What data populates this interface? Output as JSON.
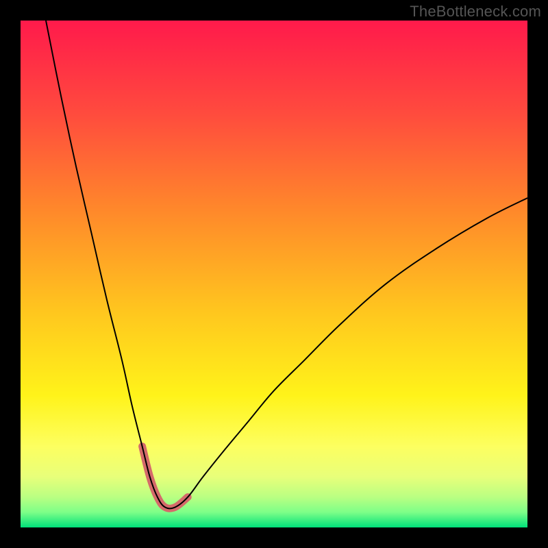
{
  "watermark": {
    "text": "TheBottleneck.com"
  },
  "chart_data": {
    "type": "line",
    "title": "",
    "xlabel": "",
    "ylabel": "",
    "xlim": [
      0,
      100
    ],
    "ylim": [
      0,
      100
    ],
    "grid": false,
    "legend": false,
    "annotations": [],
    "background_gradient_stops": [
      {
        "pct": 0,
        "color": "#ff1a4b"
      },
      {
        "pct": 18,
        "color": "#ff4a3e"
      },
      {
        "pct": 38,
        "color": "#ff8a2a"
      },
      {
        "pct": 58,
        "color": "#ffc81e"
      },
      {
        "pct": 74,
        "color": "#fff31a"
      },
      {
        "pct": 84,
        "color": "#fdff60"
      },
      {
        "pct": 90,
        "color": "#e8ff7a"
      },
      {
        "pct": 94,
        "color": "#baff82"
      },
      {
        "pct": 97,
        "color": "#7dff88"
      },
      {
        "pct": 100,
        "color": "#00e07a"
      }
    ],
    "series": [
      {
        "name": "bottleneck-curve",
        "color": "#000000",
        "stroke_width": 2,
        "x": [
          5,
          8,
          11,
          14,
          17,
          20,
          22,
          24,
          25.5,
          27,
          28.5,
          30.5,
          33,
          36,
          40,
          45,
          50,
          56,
          63,
          72,
          82,
          92,
          100
        ],
        "values": [
          100,
          85,
          71,
          58,
          45,
          33,
          24,
          16,
          10,
          6,
          4,
          4,
          6,
          10,
          15,
          21,
          27,
          33,
          40,
          48,
          55,
          61,
          65
        ]
      },
      {
        "name": "highlight-band",
        "color": "#d46a6a",
        "stroke_width": 11,
        "linecap": "round",
        "x": [
          24,
          25.5,
          27,
          28.5,
          30.5,
          33
        ],
        "values": [
          16,
          10,
          6,
          4,
          4,
          6
        ]
      }
    ]
  }
}
